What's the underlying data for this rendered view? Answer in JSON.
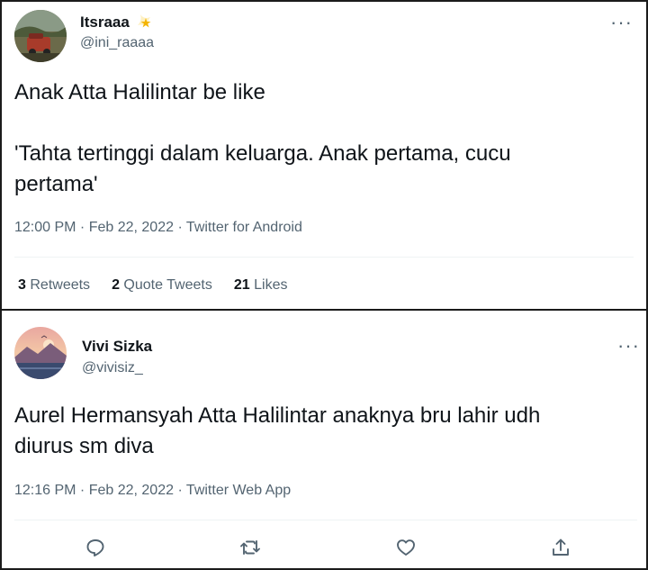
{
  "tweets": [
    {
      "name": "Itsraaa",
      "handle": "@ini_raaaa",
      "text_lines": [
        "Anak Atta Halilintar be like",
        "",
        "'Tahta tertinggi dalam keluarga. Anak pertama, cucu",
        "pertama'"
      ],
      "meta": "12:00 PM · Feb 22, 2022 · Twitter for Android",
      "stats": {
        "retweets_count": "3",
        "retweets_label": "Retweets",
        "quotes_count": "2",
        "quotes_label": "Quote Tweets",
        "likes_count": "21",
        "likes_label": "Likes"
      },
      "more": "···"
    },
    {
      "name": "Vivi Sizka",
      "handle": "@vivisiz_",
      "text_lines": [
        "Aurel Hermansyah Atta Halilintar anaknya bru lahir udh",
        "diurus sm diva"
      ],
      "meta": "12:16 PM · Feb 22, 2022 · Twitter Web App",
      "more": "···"
    }
  ],
  "icons": {
    "star_emoji": "sparkle-star-icon",
    "reply": "reply-icon",
    "retweet": "retweet-icon",
    "like": "heart-icon",
    "share": "share-icon"
  },
  "colors": {
    "text_primary": "#0f1419",
    "text_secondary": "#536471",
    "star": "#f4b400"
  }
}
